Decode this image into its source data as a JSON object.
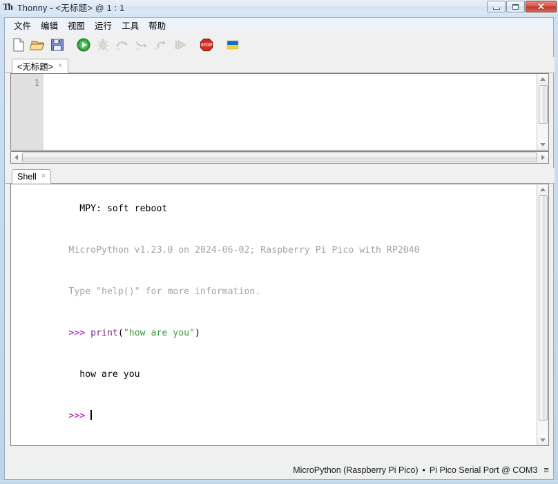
{
  "window": {
    "title": "Thonny  -  <无标题>  @  1 : 1",
    "app_icon": "thonny-logo-icon",
    "minimize_label": "",
    "maximize_label": "",
    "close_label": "✕"
  },
  "menubar": {
    "items": [
      {
        "label": "文件",
        "name": "menu-file"
      },
      {
        "label": "编辑",
        "name": "menu-edit"
      },
      {
        "label": "视图",
        "name": "menu-view"
      },
      {
        "label": "运行",
        "name": "menu-run"
      },
      {
        "label": "工具",
        "name": "menu-tools"
      },
      {
        "label": "帮助",
        "name": "menu-help"
      }
    ]
  },
  "toolbar": {
    "buttons": [
      {
        "name": "new-file-icon",
        "title": "新建",
        "enabled": true
      },
      {
        "name": "open-file-icon",
        "title": "打开",
        "enabled": true
      },
      {
        "name": "save-file-icon",
        "title": "保存",
        "enabled": true
      },
      {
        "name": "run-icon",
        "title": "运行",
        "enabled": true
      },
      {
        "name": "debug-icon",
        "title": "调试",
        "enabled": false
      },
      {
        "name": "step-over-icon",
        "title": "跳过",
        "enabled": false
      },
      {
        "name": "step-into-icon",
        "title": "步入",
        "enabled": false
      },
      {
        "name": "step-out-icon",
        "title": "步出",
        "enabled": false
      },
      {
        "name": "resume-icon",
        "title": "继续",
        "enabled": false
      },
      {
        "name": "stop-icon",
        "title": "停止",
        "enabled": true
      },
      {
        "name": "ukraine-flag-icon",
        "title": "Ukraine",
        "enabled": true
      }
    ]
  },
  "editor": {
    "tab_label": "<无标题>",
    "tab_close": "×",
    "line_numbers": [
      "1"
    ],
    "content": ""
  },
  "shell": {
    "tab_label": "Shell",
    "tab_close": "×",
    "lines": [
      {
        "segments": [
          {
            "text": "  MPY: soft reboot",
            "style": "black"
          }
        ]
      },
      {
        "segments": [
          {
            "text": "MicroPython v1.23.0 on 2024-06-02; Raspberry Pi Pico with RP2040",
            "style": "gray"
          }
        ]
      },
      {
        "segments": [
          {
            "text": "Type \"help()\" for more information.",
            "style": "gray"
          }
        ]
      },
      {
        "segments": [
          {
            "text": ">>> ",
            "style": "prompt"
          },
          {
            "text": "print",
            "style": "keyword"
          },
          {
            "text": "(",
            "style": "black"
          },
          {
            "text": "\"how are you\"",
            "style": "string"
          },
          {
            "text": ")",
            "style": "black"
          }
        ]
      },
      {
        "segments": [
          {
            "text": "  how are you",
            "style": "black"
          }
        ]
      },
      {
        "segments": [
          {
            "text": ">>> ",
            "style": "prompt"
          }
        ],
        "caret": true
      }
    ]
  },
  "statusbar": {
    "interpreter": "MicroPython (Raspberry Pi Pico)",
    "separator": "•",
    "port": "Pi Pico Serial Port @ COM3",
    "menu_icon": "≡"
  },
  "colors": {
    "prompt": "#b000b0",
    "keyword": "#7d2b8f",
    "string": "#3a9b3a",
    "muted": "#a3a3a3",
    "window_chrome": "#d6e4f2",
    "toolbar_bg": "#f0f0f0",
    "gutter_bg": "#e0e0e0"
  }
}
